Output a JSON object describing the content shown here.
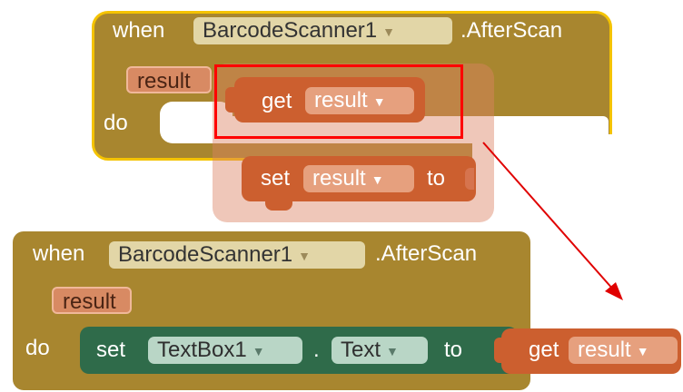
{
  "top_event": {
    "when": "when",
    "component": "BarcodeScanner1",
    "event": ".AfterScan",
    "param": "result",
    "do": "do"
  },
  "dragged_blocks": {
    "get_label": "get",
    "get_var": "result",
    "set_label": "set",
    "set_var": "result",
    "to_label": "to"
  },
  "bottom_event": {
    "when": "when",
    "component": "BarcodeScanner1",
    "event": ".AfterScan",
    "param": "result",
    "do": "do",
    "set_label": "set",
    "target_component": "TextBox1",
    "dot": ".",
    "property": "Text",
    "to_label": "to",
    "get_label": "get",
    "get_var": "result"
  },
  "icons": {
    "dropdown": "chevron-down-icon",
    "arrow": "red-arrow"
  },
  "colors": {
    "event_block": "#a8862f",
    "event_border": "#f4c300",
    "variable_block": "#cc5f2f",
    "component_set_block": "#2f6b4a",
    "highlight": "#ff0000"
  }
}
